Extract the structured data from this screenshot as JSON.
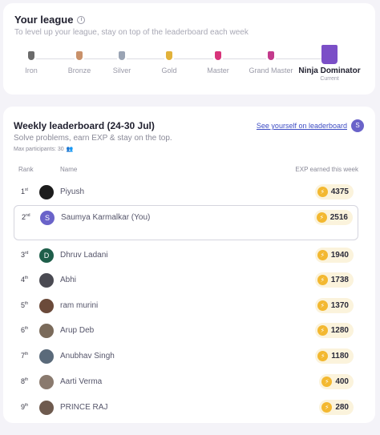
{
  "league": {
    "title": "Your league",
    "subtitle": "To level up your league, stay on top of the leaderboard each week",
    "tiers": [
      {
        "label": "Iron",
        "color": "#6b6b6b"
      },
      {
        "label": "Bronze",
        "color": "#c9916a"
      },
      {
        "label": "Silver",
        "color": "#9aa4b4"
      },
      {
        "label": "Gold",
        "color": "#e2b23a"
      },
      {
        "label": "Master",
        "color": "#d8347a"
      },
      {
        "label": "Grand Master",
        "color": "#c33a8c"
      },
      {
        "label": "Ninja Dominator",
        "color": "#7b4fc7",
        "status": "Current"
      }
    ]
  },
  "leaderboard": {
    "title": "Weekly leaderboard (24-30 Jul)",
    "subtitle": "Solve problems, earn EXP & stay on the top.",
    "max_participants": "Max participants: 30",
    "see_yourself": "See yourself on leaderboard",
    "self_initial": "S",
    "columns": {
      "rank": "Rank",
      "name": "Name",
      "exp": "EXP earned this week"
    },
    "rows": [
      {
        "rank": "1",
        "suffix": "st",
        "name": "Piyush",
        "exp": "4375",
        "avatar_color": "#1c1c1c",
        "initial": ""
      },
      {
        "rank": "2",
        "suffix": "nd",
        "name": "Saumya Karmalkar (You)",
        "exp": "2516",
        "avatar_color": "#6a63c9",
        "initial": "S"
      },
      {
        "rank": "3",
        "suffix": "rd",
        "name": "Dhruv Ladani",
        "exp": "1940",
        "avatar_color": "#1e5e4a",
        "initial": "D"
      },
      {
        "rank": "4",
        "suffix": "th",
        "name": "Abhi",
        "exp": "1738",
        "avatar_color": "#4a4a52",
        "initial": ""
      },
      {
        "rank": "5",
        "suffix": "th",
        "name": "ram murini",
        "exp": "1370",
        "avatar_color": "#6b4a3a",
        "initial": ""
      },
      {
        "rank": "6",
        "suffix": "th",
        "name": "Arup Deb",
        "exp": "1280",
        "avatar_color": "#7a6a5a",
        "initial": ""
      },
      {
        "rank": "7",
        "suffix": "th",
        "name": "Anubhav Singh",
        "exp": "1180",
        "avatar_color": "#5a6a7a",
        "initial": ""
      },
      {
        "rank": "8",
        "suffix": "th",
        "name": "Aarti Verma",
        "exp": "400",
        "avatar_color": "#8a7a6e",
        "initial": ""
      },
      {
        "rank": "9",
        "suffix": "th",
        "name": "PRINCE RAJ",
        "exp": "280",
        "avatar_color": "#6e5a4e",
        "initial": ""
      }
    ]
  }
}
